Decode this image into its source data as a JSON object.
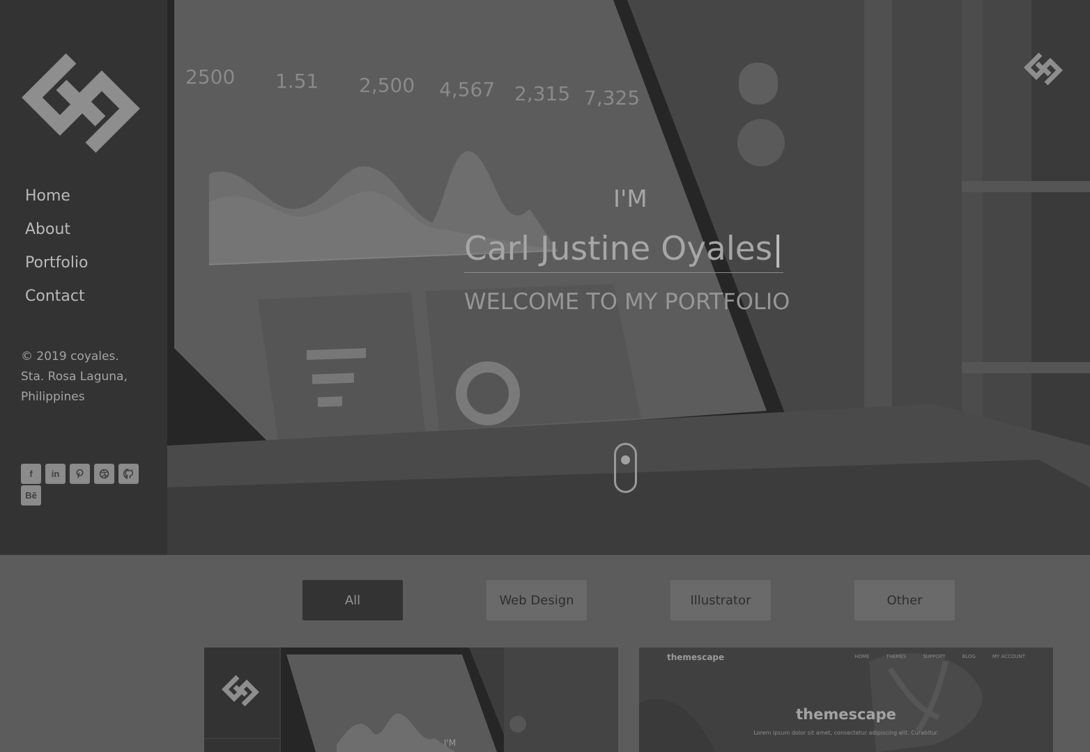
{
  "sidebar": {
    "nav": [
      "Home",
      "About",
      "Portfolio",
      "Contact"
    ],
    "info_lines": [
      "© 2019 coyales.",
      "Sta. Rosa Laguna,",
      "Philippines"
    ],
    "socials": [
      {
        "icon": "facebook-icon",
        "glyph": "f"
      },
      {
        "icon": "linkedin-icon",
        "glyph": "in"
      },
      {
        "icon": "pinterest-icon",
        "glyph": "P"
      },
      {
        "icon": "dribbble-icon",
        "glyph": ""
      },
      {
        "icon": "github-icon",
        "glyph": ""
      },
      {
        "icon": "behance-icon",
        "glyph": "Bē"
      }
    ]
  },
  "hero": {
    "im": "I'M",
    "name": "Carl Justine Oyales",
    "cursor": "|",
    "welcome": "WELCOME TO MY PORTFOLIO",
    "dashboard_stats": [
      "2500",
      "1.51",
      "2,500",
      "4,567",
      "2,315",
      "7,325"
    ]
  },
  "filters": {
    "all": "All",
    "web_design": "Web Design",
    "illustrator": "Illustrator",
    "other": "Other"
  },
  "cards": {
    "card2": {
      "brand": "themescape",
      "nav": [
        "HOME",
        "THEMES",
        "SUPPORT",
        "BLOG",
        "MY ACCOUNT"
      ],
      "title": "themescape",
      "tagline": "Lorem ipsum dolor sit amet, consectetur adipiscing elit. Curabitur."
    },
    "card1": {
      "im": "I'M"
    }
  },
  "colors": {
    "sidebar_bg": "#333333",
    "page_bg": "#5c5c5c",
    "active_filter": "#333333",
    "filter_bg": "#6a6a6a",
    "text_light": "#a6a6a6"
  }
}
